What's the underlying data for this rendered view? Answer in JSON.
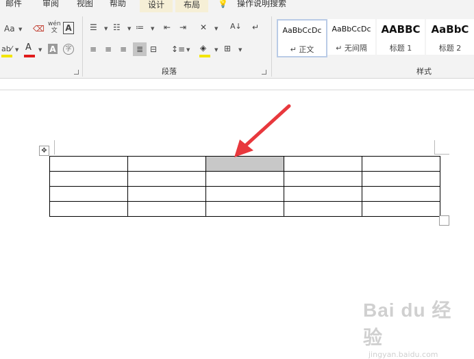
{
  "tabs": [
    "邮件",
    "审阅",
    "视图",
    "帮助",
    "设计",
    "布局",
    "操作说明搜索"
  ],
  "ribbon": {
    "font_group": {
      "change_case": "Aa",
      "phonetic_top": "wén",
      "phonetic_bottom": "文",
      "char_border": "A",
      "font_color": "A",
      "char_shading": "A",
      "enclose_char": "字",
      "highlight_color": "#f2e600",
      "font_color_value": "#e01b1b"
    },
    "paragraph_group": {
      "label": "段落"
    },
    "styles_group": {
      "label": "样式",
      "items": [
        {
          "sample": "AaBbCcDc",
          "name": "正文",
          "mark": "↵"
        },
        {
          "sample": "AaBbCcDc",
          "name": "无间隔",
          "mark": "↵"
        },
        {
          "sample": "AABBC",
          "name": "标题 1"
        },
        {
          "sample": "AaBbC",
          "name": "标题 2"
        }
      ]
    }
  },
  "table": {
    "rows": 4,
    "cols": 5,
    "selected_cell": [
      0,
      2
    ]
  },
  "annotation": {
    "arrow_color": "#e8383d"
  },
  "watermark": {
    "brand": "Bai du 经验",
    "url": "jingyan.baidu.com"
  }
}
